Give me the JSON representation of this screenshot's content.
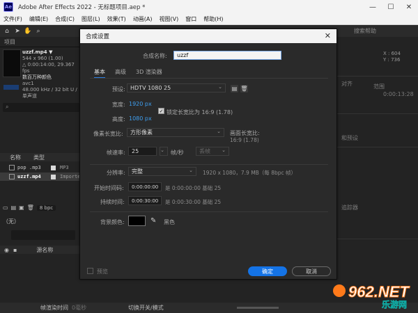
{
  "window": {
    "logo": "Ae",
    "title": "Adobe After Effects 2022 - 无标题项目.aep *",
    "controls": [
      "—",
      "☐",
      "✕"
    ]
  },
  "menu": [
    "文件(F)",
    "编辑(E)",
    "合成(C)",
    "图层(L)",
    "效果(T)",
    "动画(A)",
    "视图(V)",
    "窗口",
    "帮助(H)"
  ],
  "toolbar": {
    "right_tab": "搜索帮助"
  },
  "project": {
    "tab": "项目",
    "file_name": "uzzf.mp4 ▼",
    "info": [
      "544 x 960 (1.00)",
      "△ 0:00:14:00, 29.367 fps",
      "数百万种颜色",
      "avc1",
      "48.000 kHz / 32 bit U / 单声道"
    ],
    "col_name": "名称",
    "col_type": "类型",
    "files": [
      {
        "name": "pop .mp3",
        "type": "MP3"
      },
      {
        "name": "uzzf.mp4",
        "type": "Importe"
      }
    ],
    "bpc": "8 bpc"
  },
  "timeline": {
    "tab": "（无）",
    "col_source": "源名称"
  },
  "status": {
    "render_label": "帧渲染时间",
    "render_time": "0毫秒",
    "switch_label": "切换开关/模式"
  },
  "right_panel": {
    "readout": [
      "X : 604",
      "Y : 736"
    ],
    "labels": [
      "对齐",
      "范围",
      "0:00:13:28",
      "和预设",
      "追踪器"
    ]
  },
  "dialog": {
    "title": "合成设置",
    "name_label": "合成名称:",
    "name_value": "uzzf",
    "tabs": [
      "基本",
      "高级",
      "3D 渲染器"
    ],
    "preset_label": "预设:",
    "preset_value": "HDTV 1080 25",
    "width_label": "宽度:",
    "width_value": "1920 px",
    "height_label": "高度:",
    "height_value": "1080 px",
    "lock_ratio": "锁定长宽比为 16:9 (1.78)",
    "pixel_ratio_label": "像素长宽比:",
    "pixel_ratio_value": "方形像素",
    "frame_ratio_label": "画面长宽比:",
    "frame_ratio_value": "16:9 (1.78)",
    "fps_label": "帧速率:",
    "fps_value": "25",
    "fps_unit": "帧/秒",
    "fps_drop": "丢帧",
    "resolution_label": "分辨率:",
    "resolution_value": "完整",
    "resolution_info": "1920 x 1080，7.9 MB（每 8bpc 帧）",
    "start_label": "开始时间码:",
    "start_value": "0:00:00:00",
    "start_info": "是 0:00:00:00  基础 25",
    "duration_label": "持续时间:",
    "duration_value": "0:00:30:00",
    "duration_info": "是 0:00:30:00  基础 25",
    "bg_label": "背景颜色:",
    "bg_value": "黑色",
    "bg_color": "#000000",
    "preview": "预览",
    "ok": "确定",
    "cancel": "取消"
  },
  "watermark": {
    "brand": "962.NET",
    "sub": "乐游网"
  },
  "colors": {
    "accent": "#1473e6",
    "link_blue": "#3f9ff0",
    "panel": "#232323",
    "dialog": "#2a2a2a"
  }
}
